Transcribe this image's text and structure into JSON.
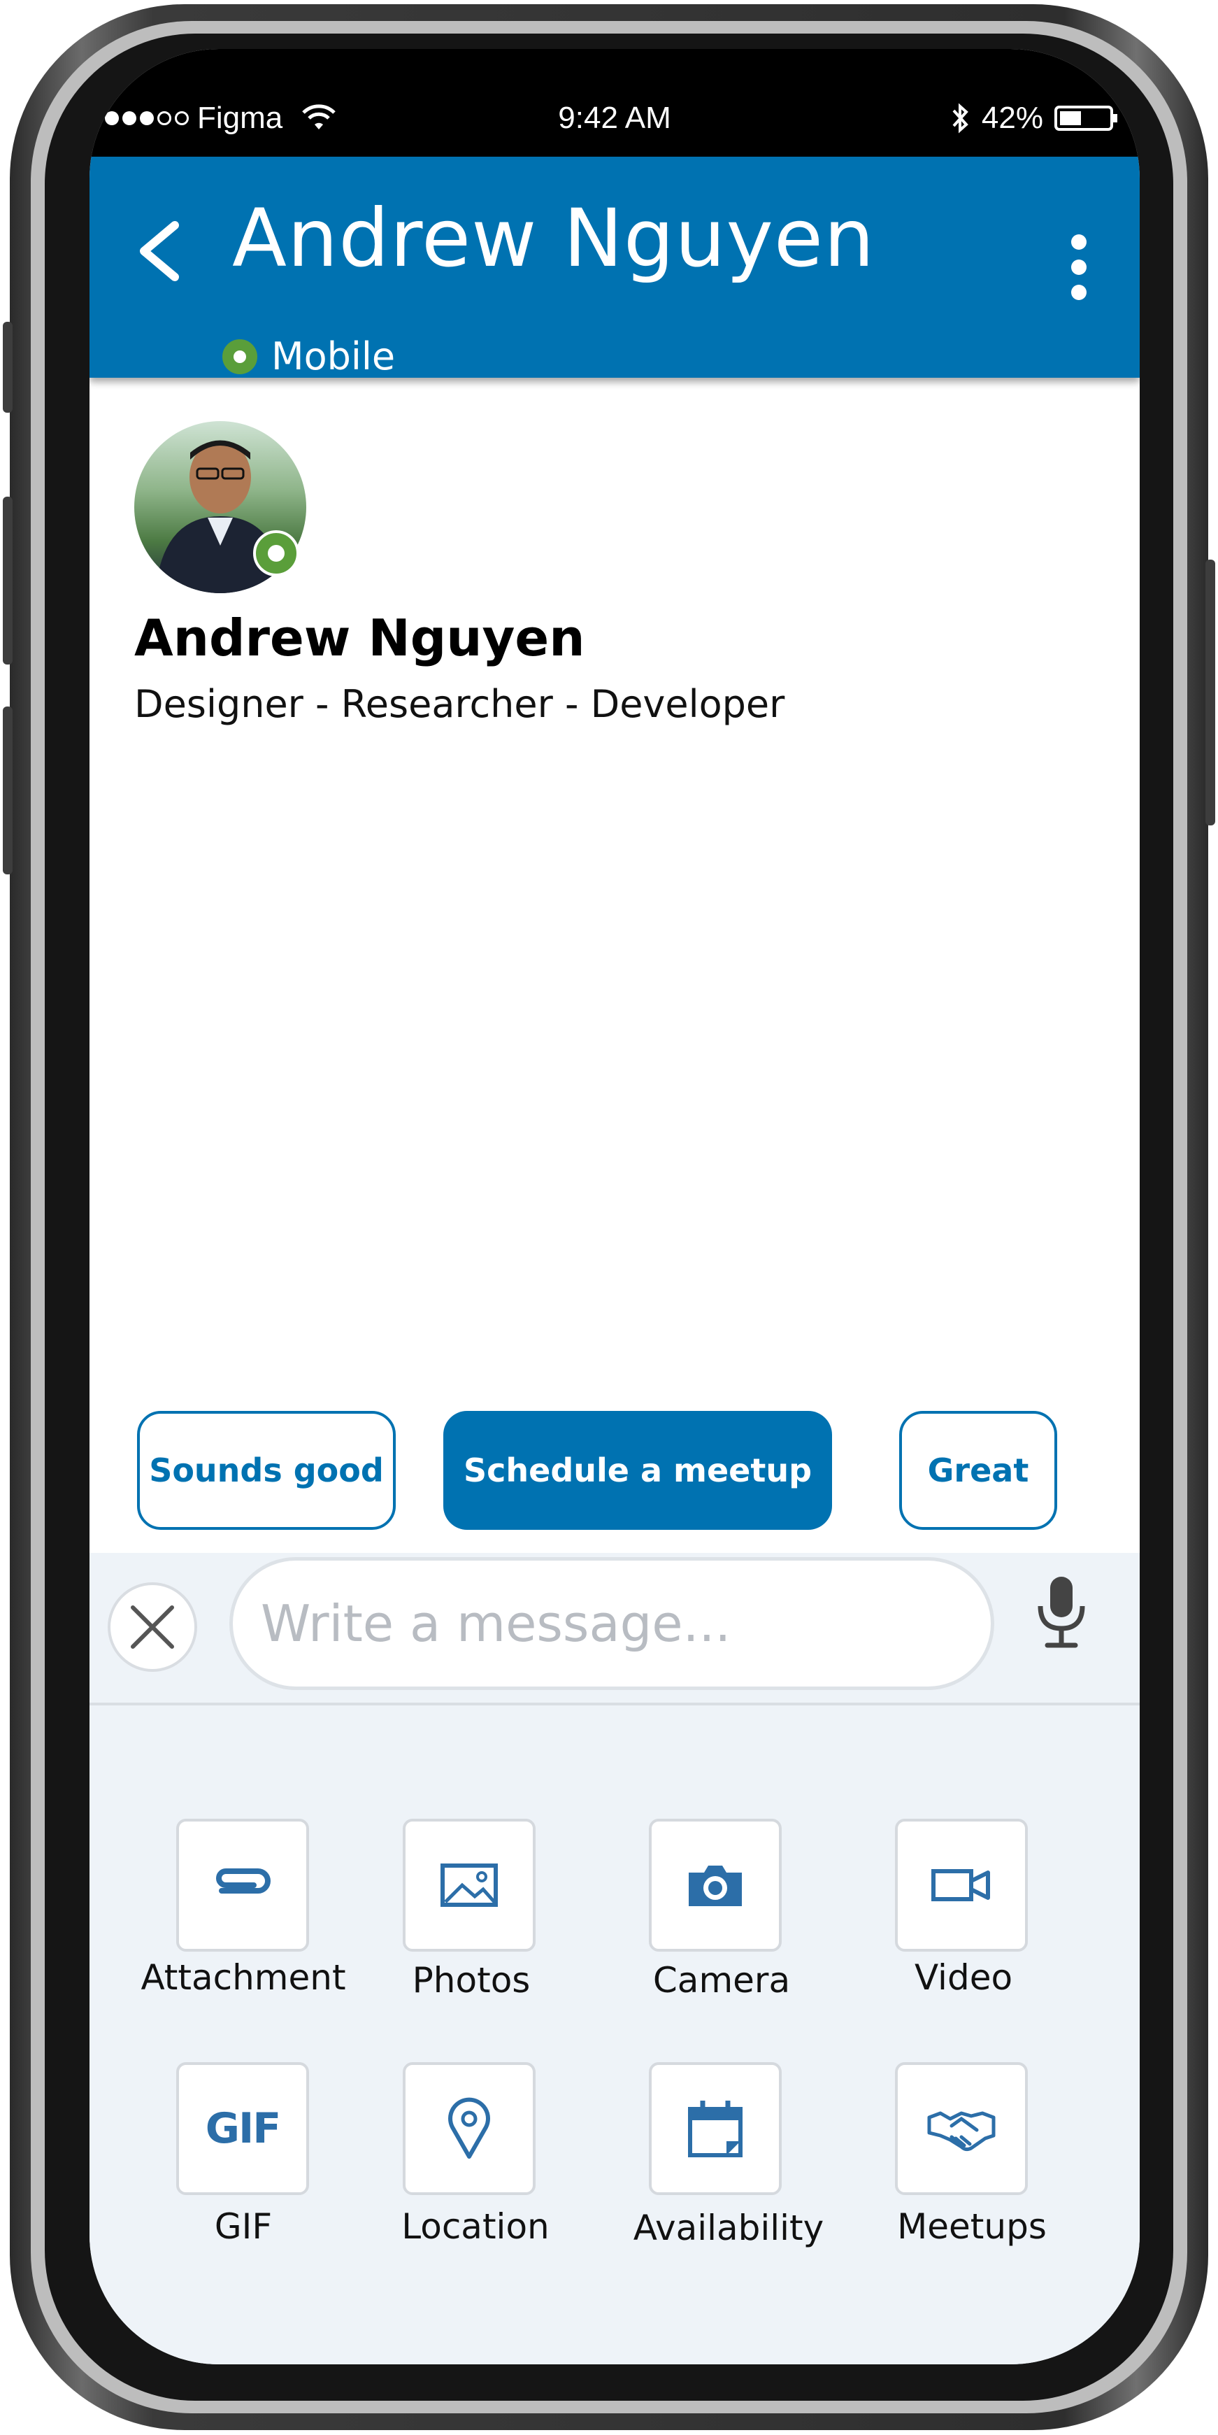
{
  "status_bar": {
    "carrier": "Figma",
    "time": "9:42 AM",
    "battery": "42%"
  },
  "header": {
    "title": "Andrew Nguyen",
    "status": "Mobile"
  },
  "profile": {
    "name": "Andrew Nguyen",
    "headline": "Designer - Researcher - Developer"
  },
  "quick_replies": [
    "Sounds good",
    "Schedule a meetup",
    "Great"
  ],
  "composer": {
    "placeholder": "Write a message..."
  },
  "attachments": [
    {
      "label": "Attachment",
      "icon": "paperclip-icon"
    },
    {
      "label": "Photos",
      "icon": "image-icon"
    },
    {
      "label": "Camera",
      "icon": "camera-icon"
    },
    {
      "label": "Video",
      "icon": "video-icon"
    },
    {
      "label": "GIF",
      "icon": "gif-icon"
    },
    {
      "label": "Location",
      "icon": "location-pin-icon"
    },
    {
      "label": "Availability",
      "icon": "calendar-icon"
    },
    {
      "label": "Meetups",
      "icon": "handshake-icon"
    }
  ],
  "colors": {
    "brand_blue": "#0072b1",
    "presence_green": "#5a9e3a",
    "tray_background": "#eef3f8",
    "icon_blue": "#2c6ea8"
  }
}
